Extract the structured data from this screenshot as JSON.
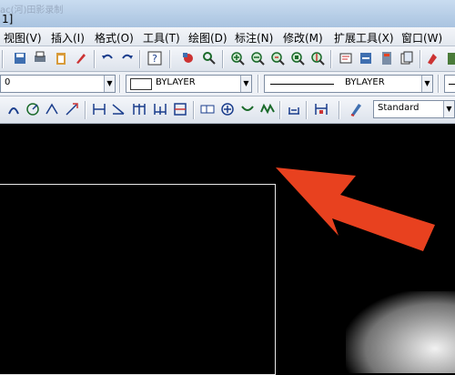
{
  "window": {
    "title_fragment": "1]",
    "ghost_text": "ac(河)田影录制"
  },
  "menu": {
    "items": [
      "视图(V)",
      "插入(I)",
      "格式(O)",
      "工具(T)",
      "绘图(D)",
      "标注(N)",
      "修改(M)",
      "扩展工具(X)",
      "窗口(W)"
    ]
  },
  "properties": {
    "layer_value": "0",
    "color_value": "BYLAYER",
    "linetype_value": "BYLAYER"
  },
  "styles": {
    "text_style": "Standard"
  },
  "annotation": {
    "arrow_color": "#e8411f"
  },
  "icons": {
    "toolbar1": [
      "qsave-icon",
      "print-icon",
      "paste-icon",
      "brush-icon",
      "undo-icon",
      "redo-icon",
      "help-icon",
      "pan-icon",
      "zoom-realtime-icon",
      "zoom-in-icon",
      "zoom-out-icon",
      "zoom-previous-icon",
      "zoom-window-icon",
      "zoom-extents-icon",
      "properties-icon",
      "design-center-icon",
      "tool-palette-icon",
      "sheet-set-icon",
      "markup-icon"
    ],
    "toolbar3": [
      "dim-linear-icon",
      "dim-aligned-icon",
      "dim-arc-icon",
      "dim-ordinate-icon",
      "dim-radius-icon",
      "dim-jogged-icon",
      "dim-diameter-icon",
      "dim-angular-icon",
      "quick-dim-icon",
      "dim-baseline-icon",
      "dim-continue-icon",
      "qleader-icon",
      "tolerance-icon",
      "center-mark-icon",
      "dim-edit-icon",
      "dim-text-edit-icon",
      "dim-update-icon",
      "dim-style-icon",
      "text-style-icon"
    ]
  }
}
